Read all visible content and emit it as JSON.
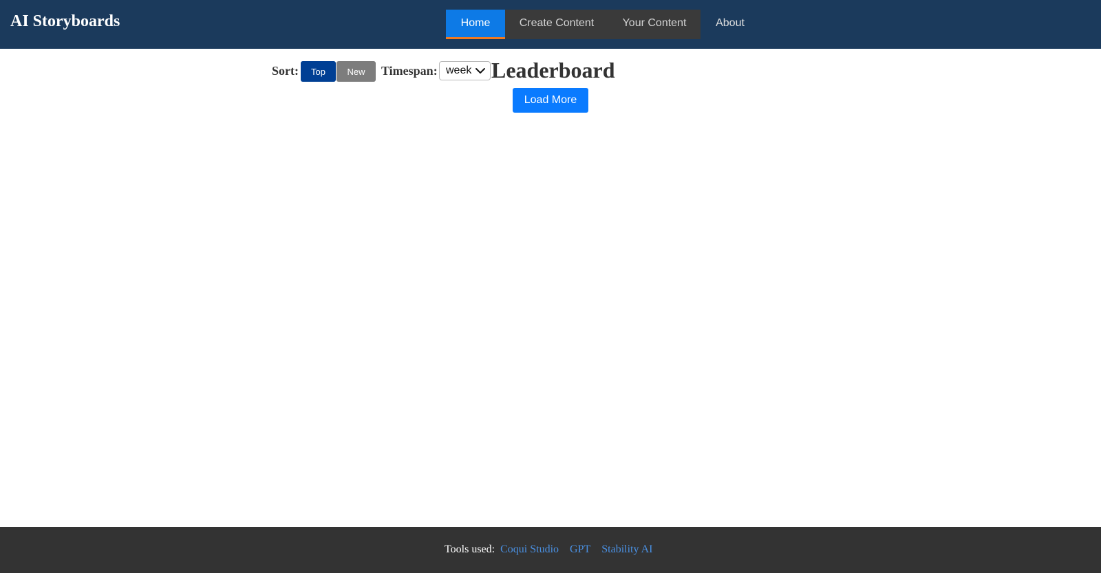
{
  "header": {
    "brand": "AI Storyboards",
    "nav": [
      {
        "label": "Home",
        "active": true
      },
      {
        "label": "Create Content"
      },
      {
        "label": "Your Content"
      },
      {
        "label": "About"
      }
    ]
  },
  "controls": {
    "sort_label": "Sort:",
    "sort_options": [
      "Top",
      "New"
    ],
    "sort_selected": "Top",
    "timespan_label": "Timespan:",
    "timespan_value": "week"
  },
  "main": {
    "title": "Leaderboard",
    "load_more": "Load More"
  },
  "footer": {
    "label": "Tools used:",
    "links": [
      "Coqui Studio",
      "GPT",
      "Stability AI"
    ]
  },
  "colors": {
    "header_bg": "#1b3a5c",
    "nav_active": "#0d7ae6",
    "nav_active_underline": "#f07a21",
    "sort_active": "#003f94",
    "sort_inactive": "#7d7d7d",
    "primary_button": "#0a7bff",
    "footer_bg": "#333333",
    "footer_link": "#4a90e2"
  }
}
